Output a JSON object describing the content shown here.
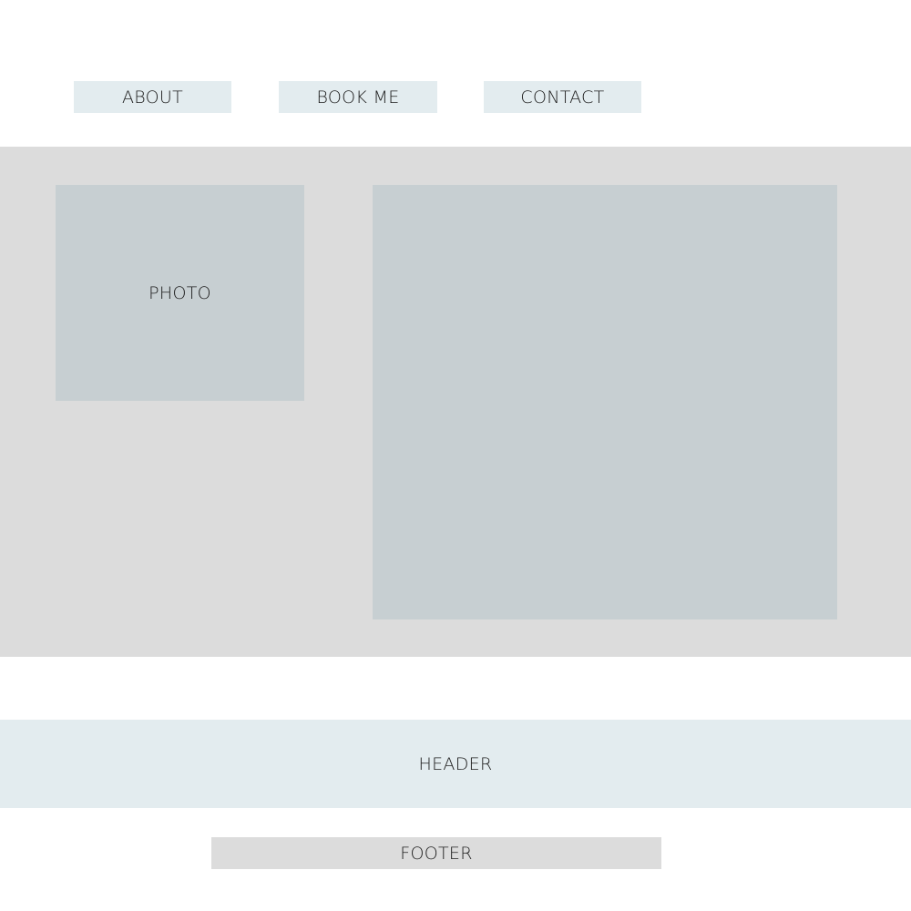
{
  "nav": {
    "items": [
      {
        "label": "ABOUT"
      },
      {
        "label": "BOOK ME"
      },
      {
        "label": "CONTACT"
      }
    ]
  },
  "main": {
    "photo_label": "PHOTO"
  },
  "header": {
    "label": "HEADER"
  },
  "footer": {
    "label": "FOOTER"
  },
  "colors": {
    "nav_bg": "#e3ecef",
    "section_bg": "#dcdcdc",
    "box_bg": "#c7cfd2",
    "header_bg": "#e3ecef",
    "footer_bg": "#dcdcdc"
  }
}
